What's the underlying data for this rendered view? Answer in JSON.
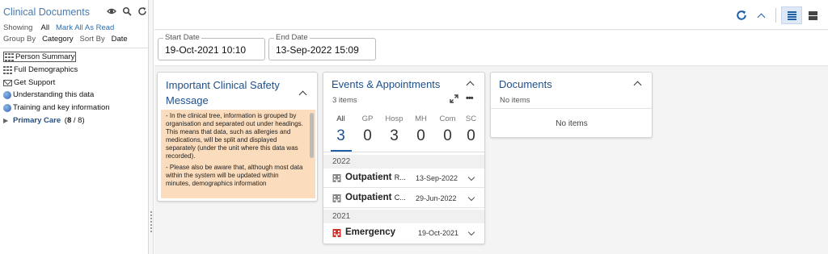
{
  "sidebar": {
    "title": "Clinical Documents",
    "icons": [
      "eye-icon",
      "search-icon",
      "refresh-icon"
    ],
    "showing_label": "Showing",
    "showing_value": "All",
    "mark_read": "Mark All As Read",
    "group_by_label": "Group By",
    "group_by_value": "Category",
    "sort_by_label": "Sort By",
    "sort_by_value": "Date",
    "tree": [
      {
        "label": "Person Summary",
        "icon": "grid-icon"
      },
      {
        "label": "Full Demographics",
        "icon": "grid-icon"
      },
      {
        "label": "Get Support",
        "icon": "mail-icon"
      },
      {
        "label": "Understanding this data",
        "icon": "info-icon"
      },
      {
        "label": "Training and key information",
        "icon": "info-icon"
      }
    ],
    "primary_care": {
      "label": "Primary Care",
      "count": "8",
      "total": "/ 8)",
      "open": "("
    }
  },
  "toolbar": {
    "icons": [
      "refresh-icon",
      "chevron-up-icon",
      "list-view-icon",
      "card-view-icon"
    ]
  },
  "dates": {
    "start_label": "Start Date",
    "start_value": "19-Oct-2021 10:10",
    "end_label": "End Date",
    "end_value": "13-Sep-2022 15:09"
  },
  "safety": {
    "title_line1": "Important Clinical Safety",
    "title_line2": "Message",
    "para1": "- In the clinical tree, information is grouped by organisation and separated out under headings. This means that data, such as allergies and medications, will be split and displayed separately (under the unit where this data was recorded).",
    "para2": "- Please also be aware that, although most data within the system will be updated within minutes, demographics information"
  },
  "events": {
    "title": "Events & Appointments",
    "count": "3 items",
    "tabs": [
      {
        "label": "All",
        "count": "3"
      },
      {
        "label": "GP",
        "count": "0"
      },
      {
        "label": "Hosp",
        "count": "3"
      },
      {
        "label": "MH",
        "count": "0"
      },
      {
        "label": "Com",
        "count": "0"
      },
      {
        "label": "SC",
        "count": "0"
      }
    ],
    "groups": [
      {
        "year": "2022",
        "rows": [
          {
            "name": "Outpatient",
            "suffix": "R...",
            "date": "13-Sep-2022"
          },
          {
            "name": "Outpatient",
            "suffix": "C...",
            "date": "29-Jun-2022"
          }
        ]
      },
      {
        "year": "2021",
        "rows": [
          {
            "name": "Emergency",
            "suffix": "",
            "date": "19-Oct-2021"
          }
        ]
      }
    ],
    "colors": {
      "hospital": "#777777",
      "emergency": "#d0312d",
      "accent": "#1f5fa8"
    }
  },
  "documents": {
    "title": "Documents",
    "count": "No items",
    "empty": "No items"
  }
}
